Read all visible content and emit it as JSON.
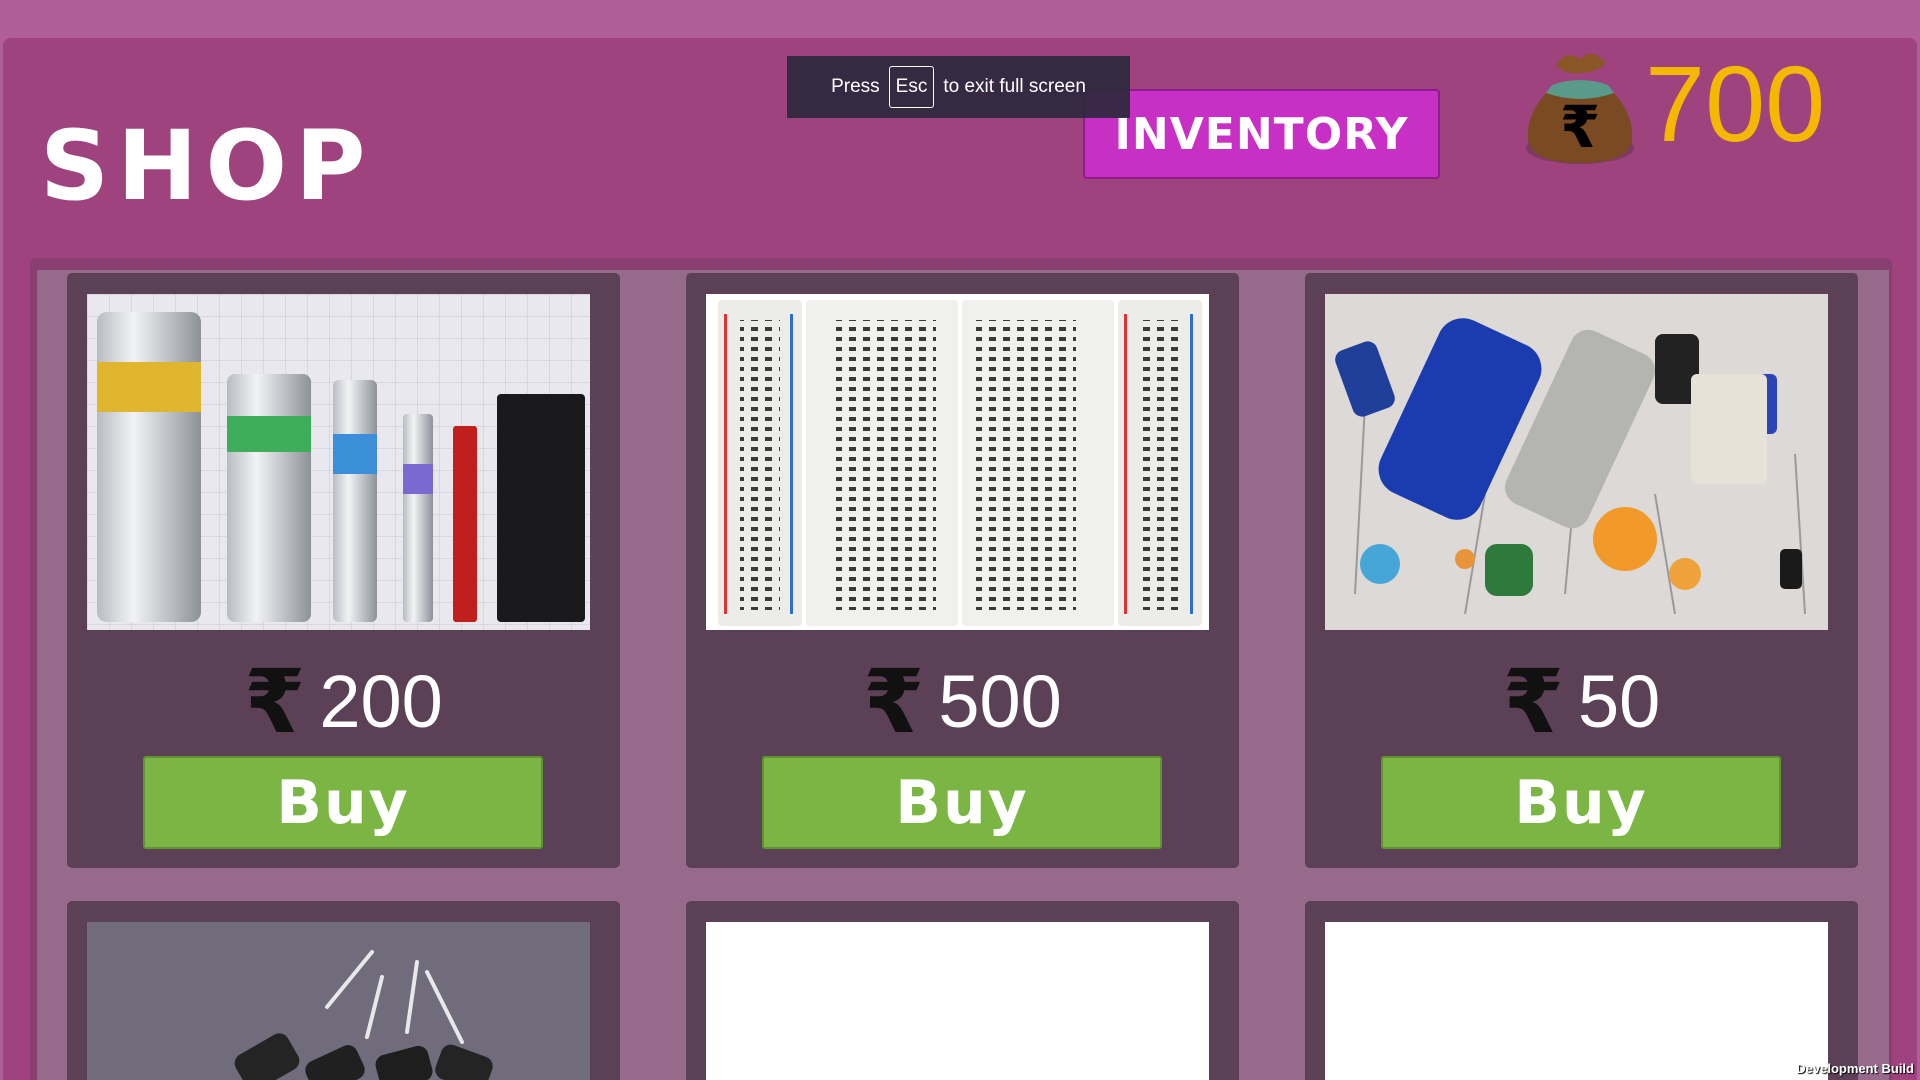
{
  "header": {
    "title": "SHOP",
    "inventory_label": "INVENTORY",
    "balance": "700"
  },
  "fullscreen_toast": {
    "before": "Press",
    "key": "Esc",
    "after": "to exit full screen"
  },
  "currency_symbol": "₹",
  "items": [
    {
      "price": "200",
      "buy_label": "Buy",
      "image": "batteries"
    },
    {
      "price": "500",
      "buy_label": "Buy",
      "image": "breadboard"
    },
    {
      "price": "50",
      "buy_label": "Buy",
      "image": "capacitors"
    },
    {
      "image": "diodes"
    },
    {
      "image": "blank"
    },
    {
      "image": "blank"
    }
  ],
  "footer": {
    "build_label": "Development Build"
  },
  "colors": {
    "background": "#b05e98",
    "panel": "#9e437e",
    "card": "#5c4055",
    "inventory_button": "#c82fc4",
    "buy_button": "#7bb543",
    "coin_text": "#f5b800"
  }
}
